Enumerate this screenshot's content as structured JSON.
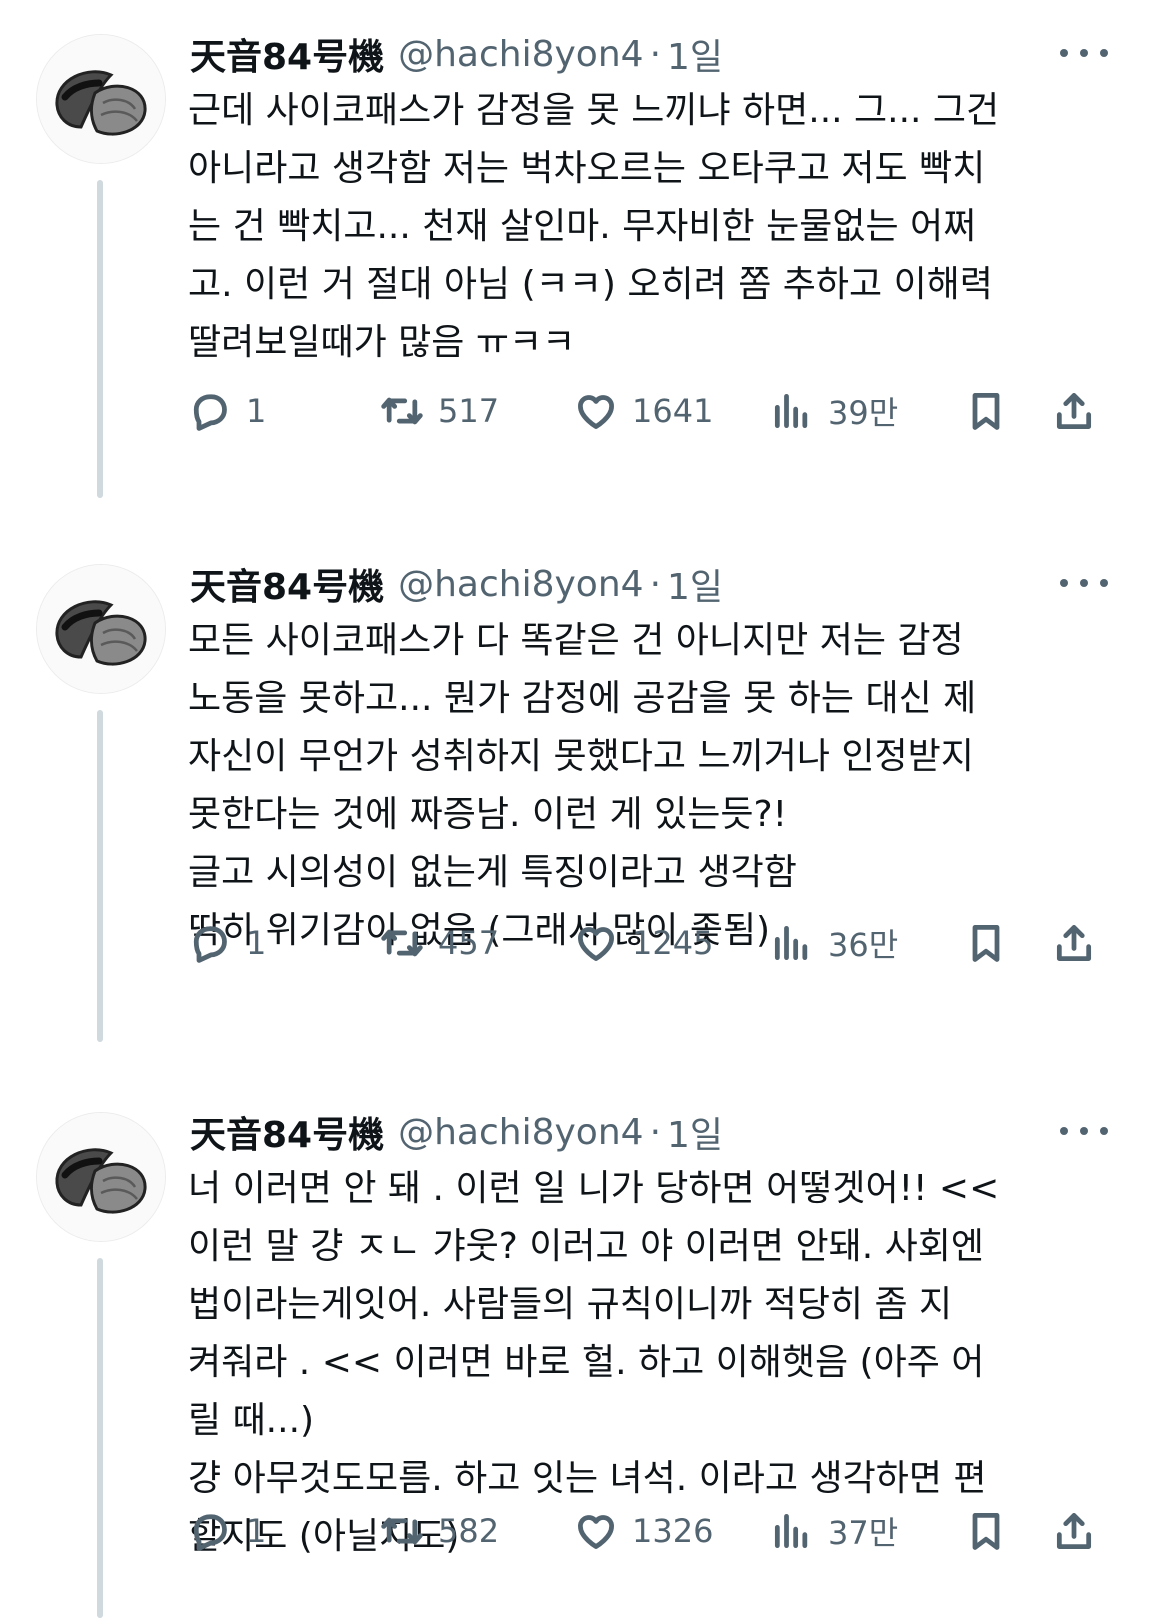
{
  "tweets": [
    {
      "author": {
        "name": "天音84号機",
        "handle": "@hachi8yon4",
        "dot": "·",
        "time": "1일"
      },
      "text": "근데 사이코패스가 감정을 못 느끼냐 하면... 그... 그건\n아니라고 생각함 저는 벅차오르는 오타쿠고 저도 빡치\n는 건 빡치고... 천재 살인마. 무자비한 눈물없는 어쩌\n고. 이런 거 절대 아님 (ㅋㅋ) 오히려 쫌 추하고 이해력\n딸려보일때가 많음 ㅠㅋㅋ",
      "stats": {
        "replies": "1",
        "retweets": "517",
        "likes": "1641",
        "views": "39만"
      }
    },
    {
      "author": {
        "name": "天音84号機",
        "handle": "@hachi8yon4",
        "dot": "·",
        "time": "1일"
      },
      "text": "모든 사이코패스가 다 똑같은 건 아니지만 저는 감정\n노동을 못하고... 뭔가 감정에 공감을 못 하는 대신 제\n자신이 무언가 성취하지 못했다고 느끼거나 인정받지\n못한다는 것에 짜증남. 이런 게 있는듯?!\n글고 시의성이 없는게 특징이라고 생각함\n딱히 위기감이 없음 (그래서 많이 좆됨)",
      "stats": {
        "replies": "1",
        "retweets": "457",
        "likes": "1245",
        "views": "36만"
      }
    },
    {
      "author": {
        "name": "天音84号機",
        "handle": "@hachi8yon4",
        "dot": "·",
        "time": "1일"
      },
      "text": "너 이러면 안 돼 . 이런 일 니가 당하면 어떻겟어!! <<\n이런 말 걍 ㅈㄴ 갸웃? 이러고 야 이러면 안돼. 사회엔\n법이라는게잇어. 사람들의 규칙이니까 적당히 좀 지\n켜줘라 . << 이러면 바로 헐. 하고 이해햇음 (아주 어\n릴 때...)\n걍 아무것도모름. 하고 잇는 녀석. 이라고 생각하면 편\n할지도 (아닐지도)",
      "stats": {
        "replies": "1",
        "retweets": "582",
        "likes": "1326",
        "views": "37만"
      }
    }
  ],
  "icons": {
    "avatar": "mochi-avatar-icon",
    "more": "more-dots-icon",
    "reply": "reply-icon",
    "retweet": "retweet-icon",
    "like": "heart-icon",
    "views": "views-bar-chart-icon",
    "bookmark": "bookmark-icon",
    "share": "share-icon"
  }
}
